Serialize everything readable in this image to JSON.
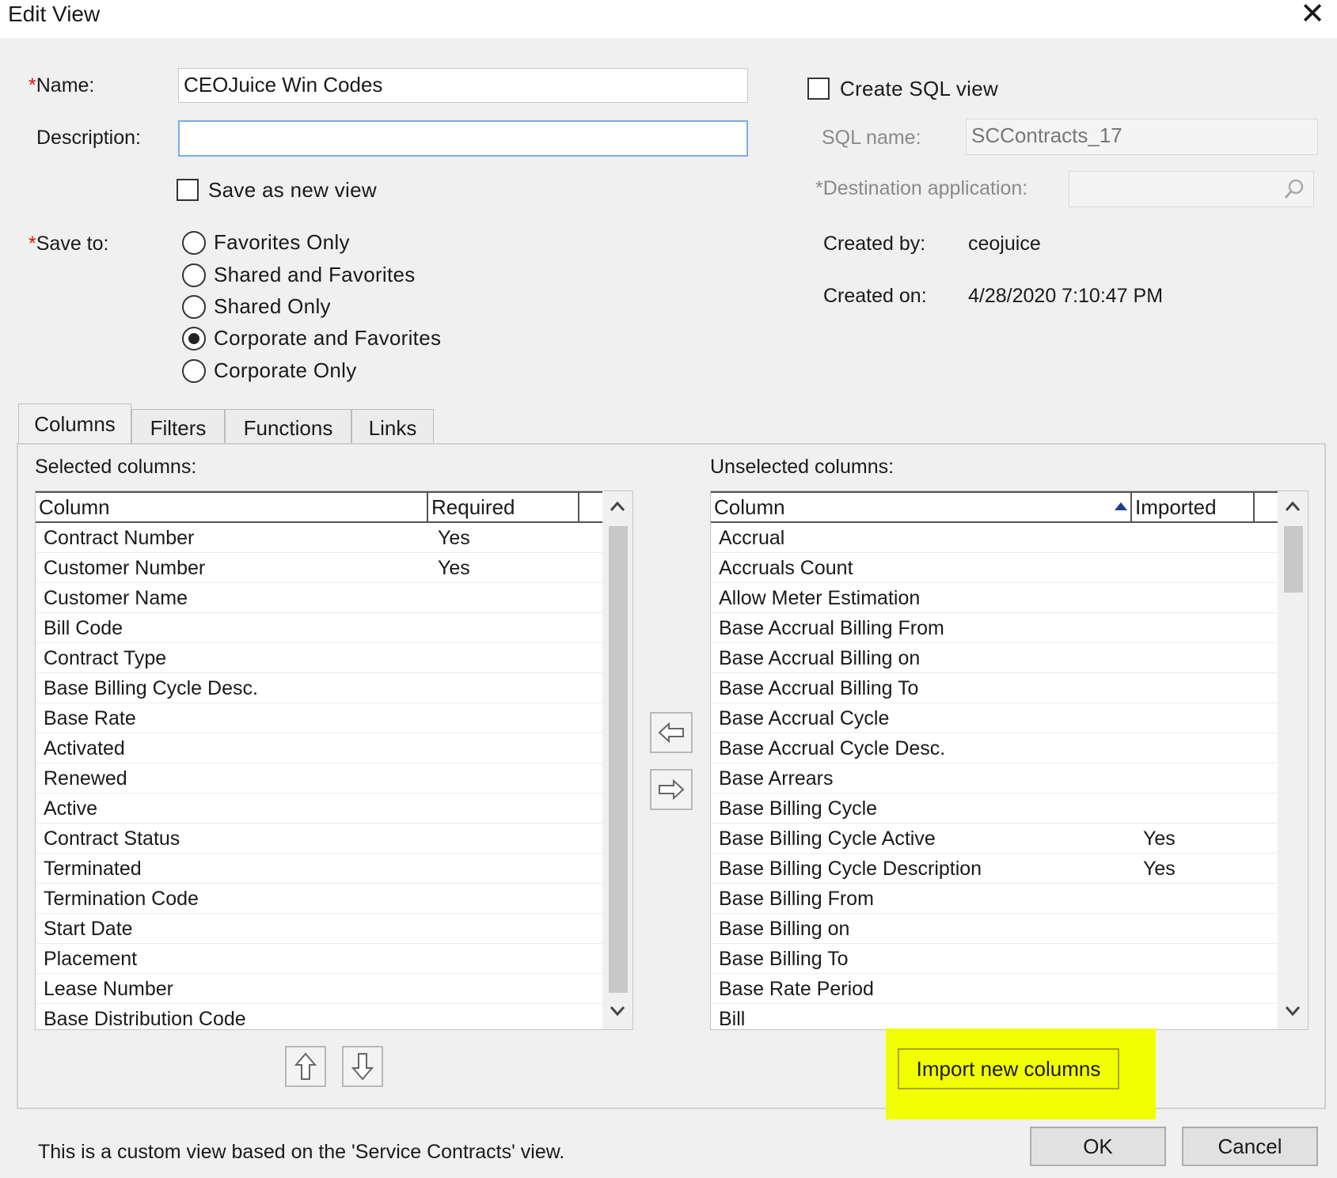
{
  "window": {
    "title": "Edit View",
    "close_glyph": "✕"
  },
  "form": {
    "name_label": "Name:",
    "name_value": "CEOJuice Win Codes",
    "description_label": "Description:",
    "description_value": "",
    "save_as_new_label": "Save as new view",
    "save_to_label": "Save to:",
    "save_options": [
      {
        "label": "Favorites Only"
      },
      {
        "label": "Shared and Favorites"
      },
      {
        "label": "Shared Only"
      },
      {
        "label": "Corporate and Favorites"
      },
      {
        "label": "Corporate Only"
      }
    ],
    "save_to_selected": "Corporate and Favorites"
  },
  "sql": {
    "create_label": "Create SQL view",
    "name_label": "SQL name:",
    "name_value": "SCContracts_17",
    "dest_label": "*Destination application:",
    "dest_value": ""
  },
  "meta": {
    "created_by_label": "Created by:",
    "created_by_value": "ceojuice",
    "created_on_label": "Created on:",
    "created_on_value": "4/28/2020 7:10:47 PM"
  },
  "tabs": [
    {
      "label": "Columns"
    },
    {
      "label": "Filters"
    },
    {
      "label": "Functions"
    },
    {
      "label": "Links"
    }
  ],
  "selected": {
    "title": "Selected columns:",
    "headers": [
      "Column",
      "Required"
    ],
    "rows": [
      {
        "column": "Contract Number",
        "value": "Yes"
      },
      {
        "column": "Customer Number",
        "value": "Yes"
      },
      {
        "column": "Customer Name",
        "value": ""
      },
      {
        "column": "Bill Code",
        "value": ""
      },
      {
        "column": "Contract Type",
        "value": ""
      },
      {
        "column": "Base Billing Cycle Desc.",
        "value": ""
      },
      {
        "column": "Base Rate",
        "value": ""
      },
      {
        "column": "Activated",
        "value": ""
      },
      {
        "column": "Renewed",
        "value": ""
      },
      {
        "column": "Active",
        "value": ""
      },
      {
        "column": "Contract Status",
        "value": ""
      },
      {
        "column": "Terminated",
        "value": ""
      },
      {
        "column": "Termination Code",
        "value": ""
      },
      {
        "column": "Start Date",
        "value": ""
      },
      {
        "column": "Placement",
        "value": ""
      },
      {
        "column": "Lease Number",
        "value": ""
      },
      {
        "column": "Base Distribution Code",
        "value": ""
      }
    ]
  },
  "unselected": {
    "title": "Unselected columns:",
    "headers": [
      "Column",
      "Imported"
    ],
    "rows": [
      {
        "column": "Accrual",
        "value": ""
      },
      {
        "column": "Accruals Count",
        "value": ""
      },
      {
        "column": "Allow Meter Estimation",
        "value": ""
      },
      {
        "column": "Base Accrual Billing From",
        "value": ""
      },
      {
        "column": "Base Accrual Billing on",
        "value": ""
      },
      {
        "column": "Base Accrual Billing To",
        "value": ""
      },
      {
        "column": "Base Accrual Cycle",
        "value": ""
      },
      {
        "column": "Base Accrual Cycle Desc.",
        "value": ""
      },
      {
        "column": "Base Arrears",
        "value": ""
      },
      {
        "column": "Base Billing Cycle",
        "value": ""
      },
      {
        "column": "Base Billing Cycle Active",
        "value": "Yes"
      },
      {
        "column": "Base Billing Cycle Description",
        "value": "Yes"
      },
      {
        "column": "Base Billing From",
        "value": ""
      },
      {
        "column": "Base Billing on",
        "value": ""
      },
      {
        "column": "Base Billing To",
        "value": ""
      },
      {
        "column": "Base Rate Period",
        "value": ""
      },
      {
        "column": "Bill",
        "value": ""
      }
    ]
  },
  "buttons": {
    "import_label": "Import new columns",
    "ok_label": "OK",
    "cancel_label": "Cancel"
  },
  "footer_text": "This is a custom view based on the 'Service Contracts' view.",
  "colors": {
    "highlight": "#f2ff00",
    "required_asterisk": "#dd1111"
  },
  "icons": [
    "close-icon",
    "checkbox-icon",
    "radio-icon",
    "arrow-left-icon",
    "arrow-right-icon",
    "arrow-up-icon",
    "arrow-down-icon",
    "search-icon",
    "sort-ascending-icon"
  ]
}
